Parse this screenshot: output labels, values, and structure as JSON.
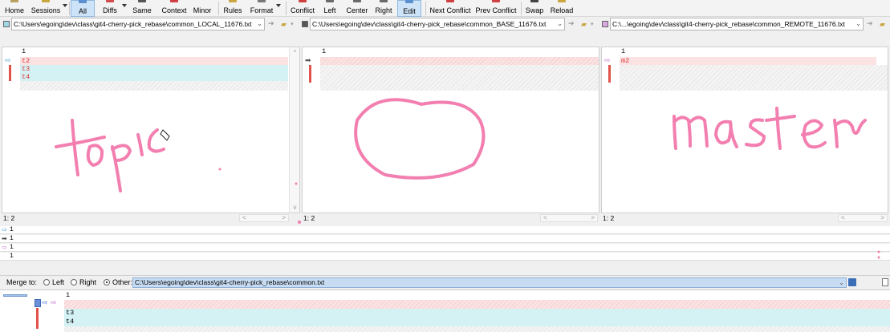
{
  "toolbar": {
    "home": "Home",
    "sessions": "Sessions",
    "all": "All",
    "diffs": "Diffs",
    "same": "Same",
    "context": "Context",
    "minor": "Minor",
    "rules": "Rules",
    "format": "Format",
    "conflict": "Conflict",
    "left": "Left",
    "center": "Center",
    "right": "Right",
    "edit": "Edit",
    "next_conflict": "Next Conflict",
    "prev_conflict": "Prev Conflict",
    "swap": "Swap",
    "reload": "Reload"
  },
  "paths": {
    "local": "C:\\Users\\egoing\\dev\\class\\git4-cherry-pick_rebase\\common_LOCAL_11676.txt",
    "base": "C:\\Users\\egoing\\dev\\class\\git4-cherry-pick_rebase\\common_BASE_11676.txt",
    "remote": "C:\\...\\egoing\\dev\\class\\git4-cherry-pick_rebase\\common_REMOTE_11676.txt"
  },
  "panes": {
    "left_lines": [
      "1",
      "t2",
      "t3",
      "t4"
    ],
    "center_lines": [
      "1"
    ],
    "right_lines": [
      "1",
      "m2"
    ],
    "left_status": "1: 2",
    "center_status": "1: 2",
    "right_status": "1: 2"
  },
  "location": {
    "rows": [
      "1",
      "1",
      "1",
      "1"
    ]
  },
  "merge": {
    "label": "Merge to:",
    "opt_left": "Left",
    "opt_right": "Right",
    "opt_other": "Other:",
    "path": "C:\\Users\\egoing\\dev\\class\\git4-cherry-pick_rebase\\common.txt"
  },
  "output": {
    "lines": [
      "1",
      "",
      "t3",
      "t4"
    ]
  },
  "annotations": {
    "left_word": "topic",
    "right_word": "master"
  },
  "colors": {
    "ink": "#f27fb0",
    "conflict_red": "#e0524a",
    "teal": "#d4f1f4",
    "pink": "#fbe3e3"
  }
}
